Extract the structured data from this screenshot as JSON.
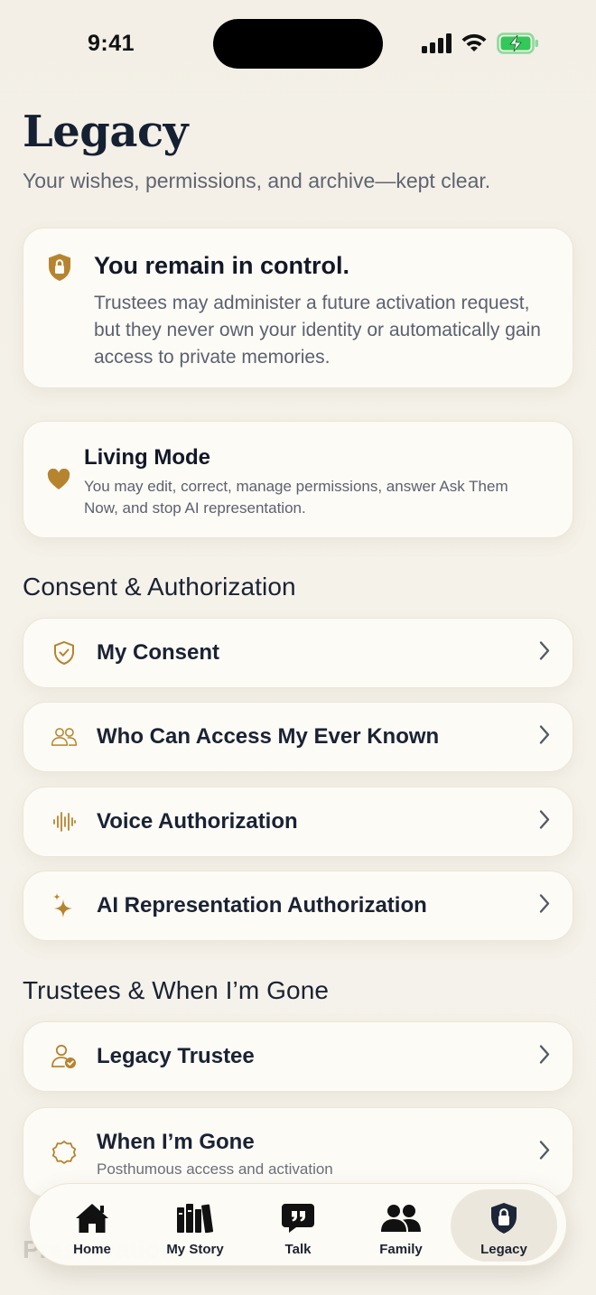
{
  "status_bar": {
    "time": "9:41"
  },
  "header": {
    "title": "Legacy",
    "subtitle": "Your wishes, permissions, and archive—kept clear."
  },
  "control_card": {
    "icon": "shield-lock-icon",
    "title": "You remain in control.",
    "text": "Trustees may administer a future activation request, but they never own your identity or automatically gain access to private memories."
  },
  "living_card": {
    "icon": "heart-icon",
    "title": "Living Mode",
    "text": "You may edit, correct, manage permissions, answer Ask Them Now, and stop AI representation."
  },
  "sections": {
    "consent": {
      "heading": "Consent & Authorization",
      "items": [
        {
          "icon": "shield-check-icon",
          "label": "My Consent"
        },
        {
          "icon": "people-icon",
          "label": "Who Can Access My Ever Known"
        },
        {
          "icon": "waveform-icon",
          "label": "Voice Authorization"
        },
        {
          "icon": "sparkles-icon",
          "label": "AI Representation Authorization"
        }
      ]
    },
    "trustees": {
      "heading": "Trustees & When I’m Gone",
      "items": [
        {
          "icon": "person-badge-icon",
          "label": "Legacy Trustee"
        },
        {
          "icon": "seal-icon",
          "label": "When I’m Gone",
          "sublabel": "Posthumous access and activation"
        }
      ]
    }
  },
  "ghost_section": "Preservation",
  "tab_bar": {
    "tabs": [
      {
        "icon": "house-icon",
        "label": "Home"
      },
      {
        "icon": "books-icon",
        "label": "My Story"
      },
      {
        "icon": "quote-bubble-icon",
        "label": "Talk"
      },
      {
        "icon": "family-icon",
        "label": "Family"
      },
      {
        "icon": "lock-icon",
        "label": "Legacy",
        "active": true
      }
    ]
  },
  "colors": {
    "accent_gold": "#b6842f",
    "ink": "#162033",
    "muted": "#5c6170",
    "card_bg": "#fdfbf6",
    "battery_green": "#34c759"
  }
}
